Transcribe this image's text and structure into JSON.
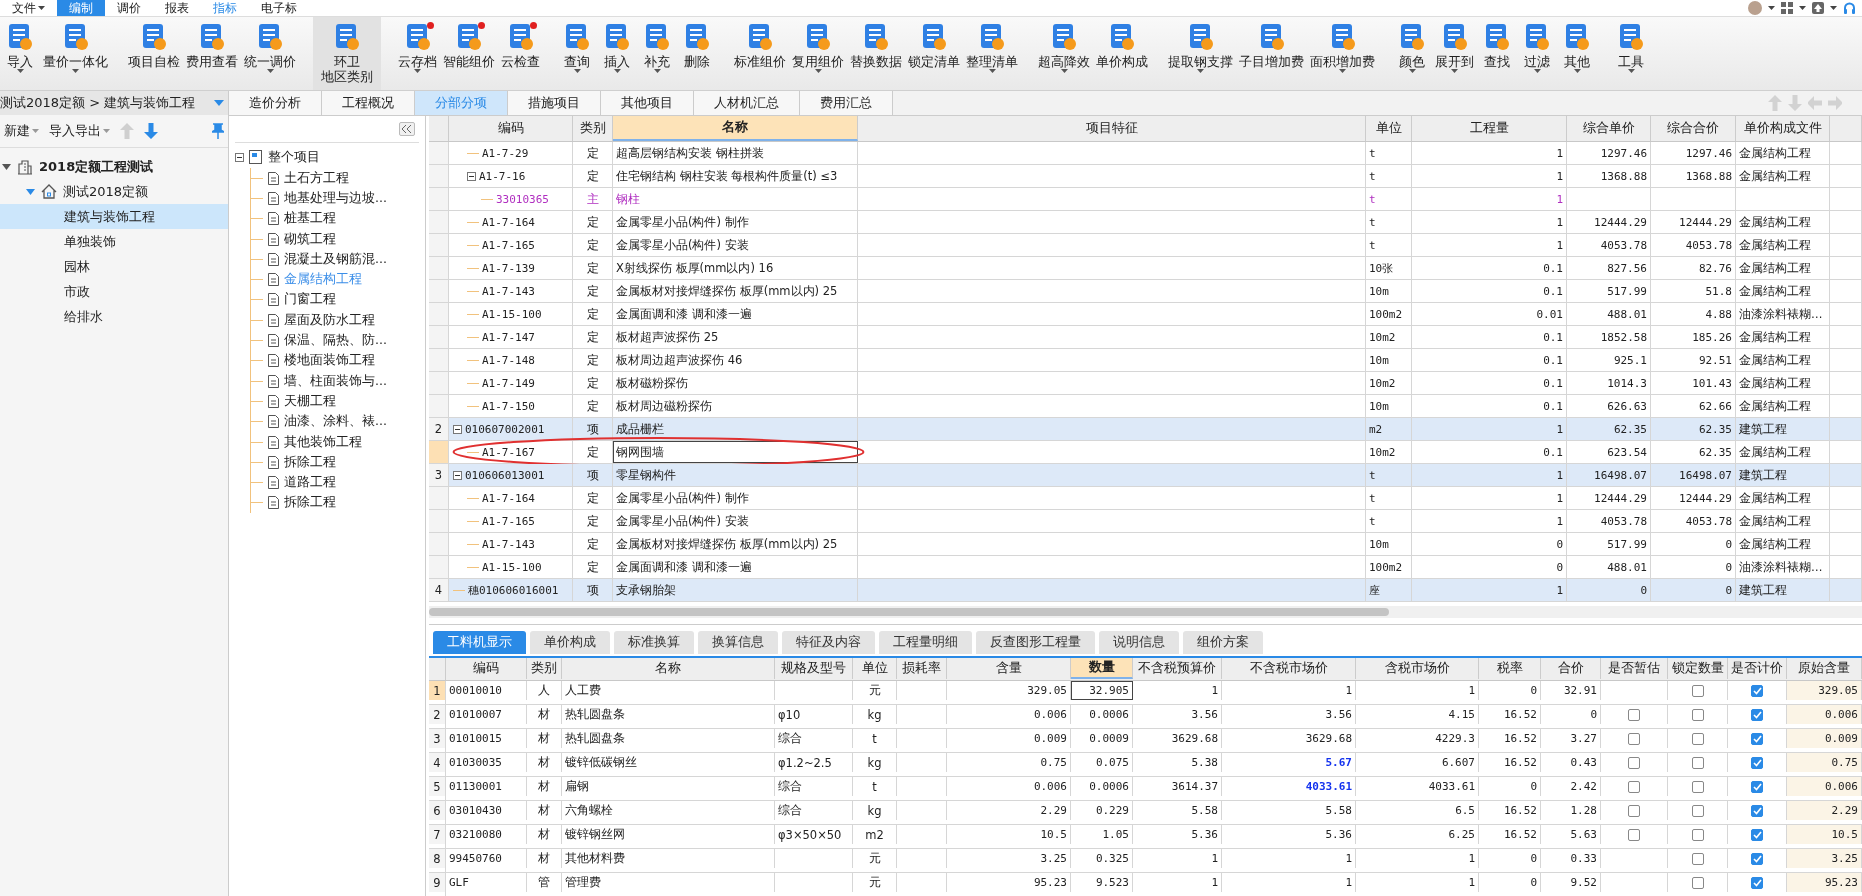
{
  "menu": [
    {
      "label": "文件",
      "dropdown": true,
      "selected": false,
      "highlighted": false
    },
    {
      "label": "编制",
      "dropdown": false,
      "selected": true,
      "highlighted": false
    },
    {
      "label": "调价",
      "dropdown": false,
      "selected": false,
      "highlighted": false
    },
    {
      "label": "报表",
      "dropdown": false,
      "selected": false,
      "highlighted": false
    },
    {
      "label": "指标",
      "dropdown": false,
      "selected": false,
      "highlighted": true
    },
    {
      "label": "电子标",
      "dropdown": false,
      "selected": false,
      "highlighted": false
    }
  ],
  "toolbar": [
    {
      "buttons": [
        {
          "label": "导入",
          "dropdown": true,
          "badge": false,
          "highlighted": false
        },
        {
          "label": "量价一体化",
          "dropdown": true,
          "badge": false,
          "highlighted": false
        }
      ]
    },
    {
      "buttons": [
        {
          "label": "项目自检",
          "dropdown": false,
          "badge": false,
          "highlighted": false
        },
        {
          "label": "费用查看",
          "dropdown": false,
          "badge": false,
          "highlighted": false
        },
        {
          "label": "统一调价",
          "dropdown": true,
          "badge": false,
          "highlighted": false
        }
      ]
    },
    {
      "buttons": [
        {
          "label": "环卫",
          "sublabel": "地区类别",
          "dropdown": false,
          "badge": false,
          "highlighted": true
        }
      ]
    },
    {
      "buttons": [
        {
          "label": "云存档",
          "dropdown": true,
          "badge": true,
          "highlighted": false
        },
        {
          "label": "智能组价",
          "dropdown": false,
          "badge": true,
          "highlighted": false
        },
        {
          "label": "云检查",
          "dropdown": false,
          "badge": true,
          "highlighted": false
        }
      ]
    },
    {
      "buttons": [
        {
          "label": "查询",
          "dropdown": true,
          "badge": false,
          "highlighted": false
        },
        {
          "label": "插入",
          "dropdown": true,
          "badge": false,
          "highlighted": false
        },
        {
          "label": "补充",
          "dropdown": true,
          "badge": false,
          "highlighted": false
        },
        {
          "label": "删除",
          "dropdown": false,
          "badge": false,
          "highlighted": false
        }
      ]
    },
    {
      "buttons": [
        {
          "label": "标准组价",
          "dropdown": false,
          "badge": false,
          "highlighted": false
        },
        {
          "label": "复用组价",
          "dropdown": true,
          "badge": false,
          "highlighted": false
        },
        {
          "label": "替换数据",
          "dropdown": false,
          "badge": false,
          "highlighted": false
        },
        {
          "label": "锁定清单",
          "dropdown": false,
          "badge": false,
          "highlighted": false
        },
        {
          "label": "整理清单",
          "dropdown": true,
          "badge": false,
          "highlighted": false
        }
      ]
    },
    {
      "buttons": [
        {
          "label": "超高降效",
          "dropdown": true,
          "badge": false,
          "highlighted": false
        },
        {
          "label": "单价构成",
          "dropdown": false,
          "badge": false,
          "highlighted": false
        }
      ]
    },
    {
      "buttons": [
        {
          "label": "提取钢支撑",
          "dropdown": true,
          "badge": false,
          "highlighted": false
        },
        {
          "label": "子目增加费",
          "dropdown": false,
          "badge": false,
          "highlighted": false
        },
        {
          "label": "面积增加费",
          "dropdown": true,
          "badge": false,
          "highlighted": false
        }
      ]
    },
    {
      "buttons": [
        {
          "label": "颜色",
          "dropdown": true,
          "badge": false,
          "highlighted": false
        },
        {
          "label": "展开到",
          "dropdown": true,
          "badge": false,
          "highlighted": false
        },
        {
          "label": "查找",
          "dropdown": false,
          "badge": false,
          "highlighted": false
        },
        {
          "label": "过滤",
          "dropdown": true,
          "badge": false,
          "highlighted": false
        },
        {
          "label": "其他",
          "dropdown": true,
          "badge": false,
          "highlighted": false
        }
      ]
    },
    {
      "buttons": [
        {
          "label": "工具",
          "dropdown": true,
          "badge": false,
          "highlighted": false
        }
      ]
    }
  ],
  "left_panel": {
    "breadcrumb": "测试2018定额 > 建筑与装饰工程",
    "actions": [
      {
        "label": "新建",
        "dropdown": true
      },
      {
        "label": "导入导出",
        "dropdown": true
      }
    ],
    "move_buttons": [
      {
        "kind": "up",
        "disabled": true
      },
      {
        "kind": "down",
        "disabled": false
      }
    ],
    "tree": [
      {
        "label": "2018定额工程测试",
        "kind": "project",
        "expanded": true,
        "selected": false,
        "children": [
          {
            "label": "测试2018定额",
            "kind": "unit",
            "expanded": true,
            "selected": false,
            "children": [
              {
                "label": "建筑与装饰工程",
                "selected": true
              },
              {
                "label": "单独装饰",
                "selected": false
              },
              {
                "label": "园林",
                "selected": false
              },
              {
                "label": "市政",
                "selected": false
              },
              {
                "label": "给排水",
                "selected": false
              }
            ]
          }
        ]
      }
    ]
  },
  "tabs": [
    {
      "label": "造价分析",
      "selected": false
    },
    {
      "label": "工程概况",
      "selected": false
    },
    {
      "label": "分部分项",
      "selected": true
    },
    {
      "label": "措施项目",
      "selected": false
    },
    {
      "label": "其他项目",
      "selected": false
    },
    {
      "label": "人材机汇总",
      "selected": false
    },
    {
      "label": "费用汇总",
      "selected": false
    }
  ],
  "division_tree": {
    "label": "整个项目",
    "expanded": true,
    "children": [
      {
        "label": "土石方工程",
        "selected": false
      },
      {
        "label": "地基处理与边坡...",
        "selected": false
      },
      {
        "label": "桩基工程",
        "selected": false
      },
      {
        "label": "砌筑工程",
        "selected": false
      },
      {
        "label": "混凝土及钢筋混...",
        "selected": false
      },
      {
        "label": "金属结构工程",
        "selected": true
      },
      {
        "label": "门窗工程",
        "selected": false
      },
      {
        "label": "屋面及防水工程",
        "selected": false
      },
      {
        "label": "保温、隔热、防...",
        "selected": false
      },
      {
        "label": "楼地面装饰工程",
        "selected": false
      },
      {
        "label": "墙、柱面装饰与...",
        "selected": false
      },
      {
        "label": "天棚工程",
        "selected": false
      },
      {
        "label": "油漆、涂料、裱...",
        "selected": false
      },
      {
        "label": "其他装饰工程",
        "selected": false
      },
      {
        "label": "拆除工程",
        "selected": false
      },
      {
        "label": "道路工程",
        "selected": false
      },
      {
        "label": "拆除工程",
        "selected": false
      }
    ]
  },
  "table": {
    "columns": [
      {
        "label": "编码",
        "selected": false
      },
      {
        "label": "类别",
        "selected": false
      },
      {
        "label": "名称",
        "selected": true
      },
      {
        "label": "项目特征",
        "selected": false
      },
      {
        "label": "单位",
        "selected": false
      },
      {
        "label": "工程量",
        "selected": false
      },
      {
        "label": "综合单价",
        "selected": false
      },
      {
        "label": "综合合价",
        "selected": false
      },
      {
        "label": "单价构成文件",
        "selected": false
      }
    ],
    "rows": [
      {
        "kind": "quota",
        "code": "A1-7-29",
        "type": "定",
        "name": "超高层钢结构安装 钢柱拼装",
        "unit": "t",
        "quantity": "1",
        "unit_price": "1297.46",
        "total": "1297.46",
        "price_file": "金属结构工程",
        "selected": false
      },
      {
        "kind": "quota",
        "code": "A1-7-16",
        "type": "定",
        "name": "住宅钢结构 钢柱安装 每根构件质量(t) ≤3",
        "unit": "t",
        "quantity": "1",
        "unit_price": "1368.88",
        "total": "1368.88",
        "price_file": "金属结构工程",
        "selected": false,
        "expanded": true,
        "children": [
          {
            "kind": "main",
            "code": "33010365",
            "type": "主",
            "name": "钢柱",
            "unit": "t",
            "quantity": "1",
            "selected": false
          }
        ]
      },
      {
        "kind": "quota",
        "code": "A1-7-164",
        "type": "定",
        "name": "金属零星小品(构件) 制作",
        "unit": "t",
        "quantity": "1",
        "unit_price": "12444.29",
        "total": "12444.29",
        "price_file": "金属结构工程",
        "selected": false
      },
      {
        "kind": "quota",
        "code": "A1-7-165",
        "type": "定",
        "name": "金属零星小品(构件) 安装",
        "unit": "t",
        "quantity": "1",
        "unit_price": "4053.78",
        "total": "4053.78",
        "price_file": "金属结构工程",
        "selected": false
      },
      {
        "kind": "quota",
        "code": "A1-7-139",
        "type": "定",
        "name": "X射线探伤 板厚(mm以内) 16",
        "unit": "10张",
        "quantity": "0.1",
        "unit_price": "827.56",
        "total": "82.76",
        "price_file": "金属结构工程",
        "selected": false
      },
      {
        "kind": "quota",
        "code": "A1-7-143",
        "type": "定",
        "name": "金属板材对接焊缝探伤 板厚(mm以内) 25",
        "unit": "10m",
        "quantity": "0.1",
        "unit_price": "517.99",
        "total": "51.8",
        "price_file": "金属结构工程",
        "selected": false
      },
      {
        "kind": "quota",
        "code": "A1-15-100",
        "type": "定",
        "name": "金属面调和漆 调和漆一遍",
        "unit": "100m2",
        "quantity": "0.01",
        "unit_price": "488.01",
        "total": "4.88",
        "price_file": "油漆涂料裱糊…",
        "selected": false
      },
      {
        "kind": "quota",
        "code": "A1-7-147",
        "type": "定",
        "name": "板材超声波探伤 25",
        "unit": "10m2",
        "quantity": "0.1",
        "unit_price": "1852.58",
        "total": "185.26",
        "price_file": "金属结构工程",
        "selected": false
      },
      {
        "kind": "quota",
        "code": "A1-7-148",
        "type": "定",
        "name": "板材周边超声波探伤 46",
        "unit": "10m",
        "quantity": "0.1",
        "unit_price": "925.1",
        "total": "92.51",
        "price_file": "金属结构工程",
        "selected": false
      },
      {
        "kind": "quota",
        "code": "A1-7-149",
        "type": "定",
        "name": "板材磁粉探伤",
        "unit": "10m2",
        "quantity": "0.1",
        "unit_price": "1014.3",
        "total": "101.43",
        "price_file": "金属结构工程",
        "selected": false
      },
      {
        "kind": "quota",
        "code": "A1-7-150",
        "type": "定",
        "name": "板材周边磁粉探伤",
        "unit": "10m",
        "quantity": "0.1",
        "unit_price": "626.63",
        "total": "62.66",
        "price_file": "金属结构工程",
        "selected": false
      },
      {
        "kind": "item",
        "no": "2",
        "code": "010607002001",
        "type": "项",
        "name": "成品栅栏",
        "unit": "m2",
        "quantity": "1",
        "unit_price": "62.35",
        "total": "62.35",
        "price_file": "建筑工程",
        "selected": false,
        "expanded": true,
        "children": [
          {
            "kind": "quota",
            "code": "A1-7-167",
            "type": "定",
            "name": "钢网围墙",
            "unit": "10m2",
            "quantity": "0.1",
            "unit_price": "623.54",
            "total": "62.35",
            "price_file": "金属结构工程",
            "selected": true,
            "circled": true
          }
        ]
      },
      {
        "kind": "item",
        "no": "3",
        "code": "010606013001",
        "type": "项",
        "name": "零星钢构件",
        "unit": "t",
        "quantity": "1",
        "unit_price": "16498.07",
        "total": "16498.07",
        "price_file": "建筑工程",
        "selected": false,
        "expanded": true,
        "children": [
          {
            "kind": "quota",
            "code": "A1-7-164",
            "type": "定",
            "name": "金属零星小品(构件) 制作",
            "unit": "t",
            "quantity": "1",
            "unit_price": "12444.29",
            "total": "12444.29",
            "price_file": "金属结构工程",
            "selected": false
          },
          {
            "kind": "quota",
            "code": "A1-7-165",
            "type": "定",
            "name": "金属零星小品(构件) 安装",
            "unit": "t",
            "quantity": "1",
            "unit_price": "4053.78",
            "total": "4053.78",
            "price_file": "金属结构工程",
            "selected": false
          },
          {
            "kind": "quota",
            "code": "A1-7-143",
            "type": "定",
            "name": "金属板材对接焊缝探伤 板厚(mm以内) 25",
            "unit": "10m",
            "quantity": "0",
            "unit_price": "517.99",
            "total": "0",
            "price_file": "金属结构工程",
            "selected": false
          },
          {
            "kind": "quota",
            "code": "A1-15-100",
            "type": "定",
            "name": "金属面调和漆 调和漆一遍",
            "unit": "100m2",
            "quantity": "0",
            "unit_price": "488.01",
            "total": "0",
            "price_file": "油漆涂料裱糊…",
            "selected": false
          }
        ]
      },
      {
        "kind": "item",
        "no": "4",
        "code": "穗010606016001",
        "type": "项",
        "name": "支承钢胎架",
        "unit": "座",
        "quantity": "1",
        "unit_price": "0",
        "total": "0",
        "price_file": "建筑工程",
        "selected": false
      }
    ]
  },
  "detail_tabs": [
    {
      "label": "工料机显示",
      "selected": true
    },
    {
      "label": "单价构成",
      "selected": false
    },
    {
      "label": "标准换算",
      "selected": false
    },
    {
      "label": "换算信息",
      "selected": false
    },
    {
      "label": "特征及内容",
      "selected": false
    },
    {
      "label": "工程量明细",
      "selected": false
    },
    {
      "label": "反查图形工程量",
      "selected": false
    },
    {
      "label": "说明信息",
      "selected": false
    },
    {
      "label": "组价方案",
      "selected": false
    }
  ],
  "detail_table": {
    "columns": [
      {
        "label": "编码",
        "selected": false
      },
      {
        "label": "类别",
        "selected": false
      },
      {
        "label": "名称",
        "selected": false
      },
      {
        "label": "规格及型号",
        "selected": false
      },
      {
        "label": "单位",
        "selected": false
      },
      {
        "label": "损耗率",
        "selected": false
      },
      {
        "label": "含量",
        "selected": false
      },
      {
        "label": "数量",
        "selected": true
      },
      {
        "label": "不含税预算价",
        "selected": false
      },
      {
        "label": "不含税市场价",
        "selected": false
      },
      {
        "label": "含税市场价",
        "selected": false
      },
      {
        "label": "税率",
        "selected": false
      },
      {
        "label": "合价",
        "selected": false
      },
      {
        "label": "是否暂估",
        "selected": false
      },
      {
        "label": "锁定数量",
        "selected": false
      },
      {
        "label": "是否计价",
        "selected": false
      },
      {
        "label": "原始含量",
        "selected": false
      }
    ],
    "rows": [
      {
        "no": "1",
        "code": "00010010",
        "type": "人",
        "name": "人工费",
        "unit": "元",
        "content": "329.05",
        "quantity": "32.905",
        "budget_price": "1",
        "market_price": "1",
        "tax_market_price": "1",
        "tax_rate": "0",
        "total": "32.91",
        "lock_quantity": false,
        "priced": true,
        "original_content": "329.05",
        "adjusted": false,
        "selected": true
      },
      {
        "no": "2",
        "code": "01010007",
        "type": "材",
        "name": "热轧圆盘条",
        "spec": "φ10",
        "unit": "kg",
        "content": "0.006",
        "quantity": "0.0006",
        "budget_price": "3.56",
        "market_price": "3.56",
        "tax_market_price": "4.15",
        "tax_rate": "16.52",
        "total": "0",
        "provisional": false,
        "lock_quantity": false,
        "priced": true,
        "original_content": "0.006",
        "adjusted": false,
        "selected": false
      },
      {
        "no": "3",
        "code": "01010015",
        "type": "材",
        "name": "热轧圆盘条",
        "spec": "综合",
        "unit": "t",
        "content": "0.009",
        "quantity": "0.0009",
        "budget_price": "3629.68",
        "market_price": "3629.68",
        "tax_market_price": "4229.3",
        "tax_rate": "16.52",
        "total": "3.27",
        "provisional": false,
        "lock_quantity": false,
        "priced": true,
        "original_content": "0.009",
        "adjusted": false,
        "selected": false
      },
      {
        "no": "4",
        "code": "01030035",
        "type": "材",
        "name": "镀锌低碳钢丝",
        "spec": "φ1.2~2.5",
        "unit": "kg",
        "content": "0.75",
        "quantity": "0.075",
        "budget_price": "5.38",
        "market_price": "5.67",
        "tax_market_price": "6.607",
        "tax_rate": "16.52",
        "total": "0.43",
        "provisional": false,
        "lock_quantity": false,
        "priced": true,
        "original_content": "0.75",
        "adjusted": true,
        "selected": false
      },
      {
        "no": "5",
        "code": "01130001",
        "type": "材",
        "name": "扁钢",
        "spec": "综合",
        "unit": "t",
        "content": "0.006",
        "quantity": "0.0006",
        "budget_price": "3614.37",
        "market_price": "4033.61",
        "tax_market_price": "4033.61",
        "tax_rate": "0",
        "total": "2.42",
        "provisional": false,
        "lock_quantity": false,
        "priced": true,
        "original_content": "0.006",
        "adjusted": true,
        "selected": false
      },
      {
        "no": "6",
        "code": "03010430",
        "type": "材",
        "name": "六角螺栓",
        "spec": "综合",
        "unit": "kg",
        "content": "2.29",
        "quantity": "0.229",
        "budget_price": "5.58",
        "market_price": "5.58",
        "tax_market_price": "6.5",
        "tax_rate": "16.52",
        "total": "1.28",
        "provisional": false,
        "lock_quantity": false,
        "priced": true,
        "original_content": "2.29",
        "adjusted": false,
        "selected": false
      },
      {
        "no": "7",
        "code": "03210080",
        "type": "材",
        "name": "镀锌钢丝网",
        "spec": "φ3×50×50",
        "unit": "m2",
        "content": "10.5",
        "quantity": "1.05",
        "budget_price": "5.36",
        "market_price": "5.36",
        "tax_market_price": "6.25",
        "tax_rate": "16.52",
        "total": "5.63",
        "provisional": false,
        "lock_quantity": false,
        "priced": true,
        "original_content": "10.5",
        "adjusted": false,
        "selected": false
      },
      {
        "no": "8",
        "code": "99450760",
        "type": "材",
        "name": "其他材料费",
        "unit": "元",
        "content": "3.25",
        "quantity": "0.325",
        "budget_price": "1",
        "market_price": "1",
        "tax_market_price": "1",
        "tax_rate": "0",
        "total": "0.33",
        "lock_quantity": false,
        "priced": true,
        "original_content": "3.25",
        "adjusted": false,
        "selected": false
      },
      {
        "no": "9",
        "code": "GLF",
        "type": "管",
        "name": "管理费",
        "unit": "元",
        "content": "95.23",
        "quantity": "9.523",
        "budget_price": "1",
        "market_price": "1",
        "tax_market_price": "1",
        "tax_rate": "0",
        "total": "9.52",
        "lock_quantity": false,
        "priced": true,
        "original_content": "95.23",
        "adjusted": false,
        "selected": false
      }
    ]
  }
}
